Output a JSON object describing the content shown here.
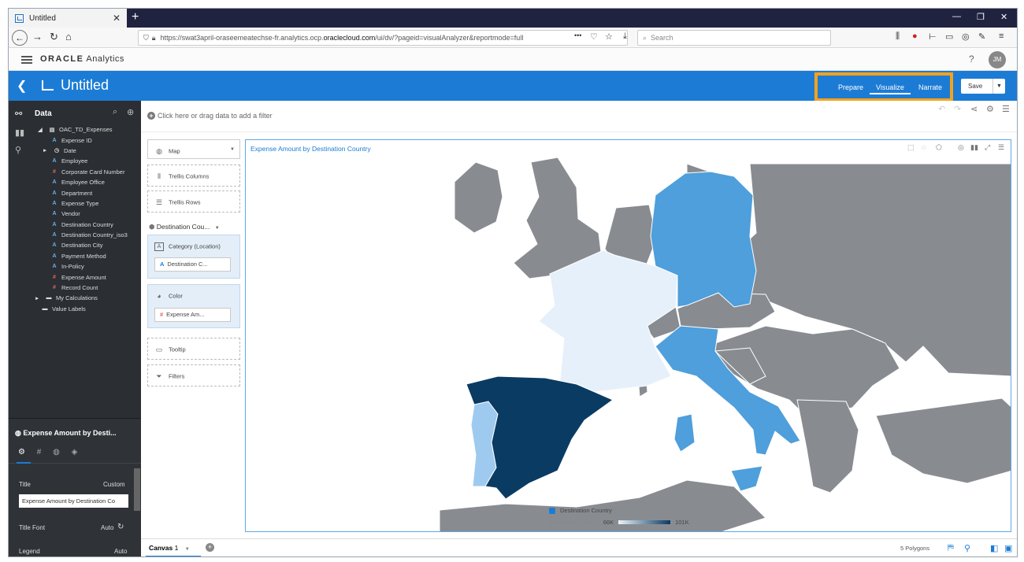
{
  "browser": {
    "tab_title": "Untitled",
    "tab_close": "✕",
    "new_tab": "+",
    "url_prefix": "https://swat3april-oraseemeatechse-fr.analytics.ocp.",
    "url_domain": "oraclecloud.com",
    "url_suffix": "/ui/dv/?pageid=visualAnalyzer&reportmode=full",
    "search_placeholder": "Search",
    "more_glyph": "•••"
  },
  "app": {
    "brand_strong": "ORACLE",
    "brand_rest": "Analytics",
    "help": "?",
    "avatar_initials": "JM"
  },
  "project": {
    "title": "Untitled",
    "modes": [
      "Prepare",
      "Visualize",
      "Narrate"
    ],
    "active_mode": "Visualize",
    "save_label": "Save"
  },
  "data_panel": {
    "header": "Data",
    "dataset": "OAC_TD_Expenses",
    "columns": [
      {
        "name": "Expense ID",
        "type": "attr"
      },
      {
        "name": "Date",
        "type": "date"
      },
      {
        "name": "Employee",
        "type": "attr"
      },
      {
        "name": "Corporate Card Number",
        "type": "meas"
      },
      {
        "name": "Employee Office",
        "type": "attr"
      },
      {
        "name": "Department",
        "type": "attr"
      },
      {
        "name": "Expense Type",
        "type": "attr"
      },
      {
        "name": "Vendor",
        "type": "attr"
      },
      {
        "name": "Destination Country",
        "type": "attr"
      },
      {
        "name": "Destination Country_iso3",
        "type": "attr"
      },
      {
        "name": "Destination City",
        "type": "attr"
      },
      {
        "name": "Payment Method",
        "type": "attr"
      },
      {
        "name": "In-Policy",
        "type": "attr"
      },
      {
        "name": "Expense Amount",
        "type": "meas"
      },
      {
        "name": "Record Count",
        "type": "meas"
      }
    ],
    "my_calculations": "My Calculations",
    "value_labels": "Value Labels"
  },
  "properties": {
    "title": "Expense Amount by Desti...",
    "title_label": "Title",
    "title_mode": "Custom",
    "title_value": "Expense Amount by Destination Co",
    "title_font_label": "Title Font",
    "title_font_value": "Auto",
    "legend_label": "Legend",
    "legend_value": "Auto"
  },
  "filter_bar": {
    "text": "Click here or drag data to add a filter"
  },
  "grammar": {
    "viz_type": "Map",
    "trellis_columns": "Trellis Columns",
    "trellis_rows": "Trellis Rows",
    "layer_name": "Destination Cou...",
    "category_label": "Category (Location)",
    "category_value": "Destination C...",
    "color_label": "Color",
    "color_value": "Expense Am...",
    "tooltip_label": "Tooltip",
    "filters_label": "Filters"
  },
  "viz": {
    "title": "Expense Amount by Destination Country",
    "legend_title": "Destination Country",
    "legend_measure": "Expense Amount",
    "legend_min": "66K",
    "legend_max": "101K"
  },
  "bottom": {
    "canvas_label": "Canvas",
    "canvas_number": "1",
    "polygon_count": "5 Polygons"
  },
  "colors": {
    "accent": "#1c7cd5",
    "highlight_border": "#f3a21e",
    "map_gray": "#888c91",
    "spain": "#0a3b63",
    "germany": "#4e9fdb",
    "italy": "#4e9fdb",
    "portugal": "#9ecaf0",
    "france": "#e6f0fa"
  }
}
